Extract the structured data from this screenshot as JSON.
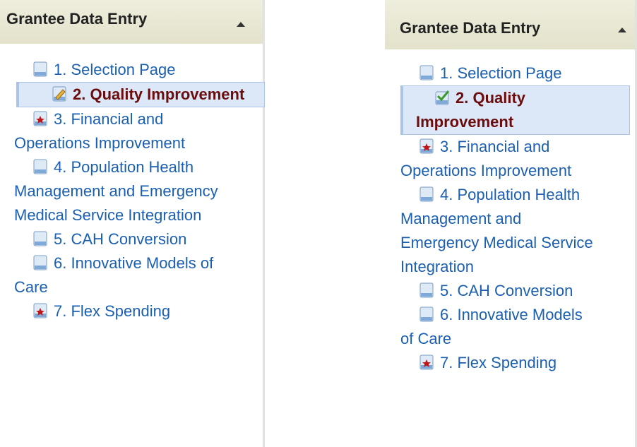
{
  "panels": [
    {
      "title": "Grantee Data Entry",
      "items": [
        {
          "label": "1. Selection Page",
          "icon": "page-icon"
        },
        {
          "label": "2. Quality Improvement",
          "icon": "edit-icon",
          "active": true
        },
        {
          "label": "3. Financial and Operations Improvement",
          "icon": "required-star-icon"
        },
        {
          "label": "4. Population Health Management and Emergency Medical Service Integration",
          "icon": "page-icon"
        },
        {
          "label": "5. CAH Conversion",
          "icon": "page-icon"
        },
        {
          "label": "6. Innovative Models of Care",
          "icon": "page-icon"
        },
        {
          "label": "7. Flex Spending",
          "icon": "required-star-icon"
        }
      ]
    },
    {
      "title": "Grantee Data Entry",
      "items": [
        {
          "label": "1. Selection Page",
          "icon": "page-icon"
        },
        {
          "label": "2. Quality Improvement",
          "icon": "checkmark-icon",
          "active": true
        },
        {
          "label": "3. Financial and Operations Improvement",
          "icon": "required-star-icon"
        },
        {
          "label": "4. Population Health Management and Emergency Medical Service Integration",
          "icon": "page-icon"
        },
        {
          "label": "5. CAH Conversion",
          "icon": "page-icon"
        },
        {
          "label": "6. Innovative Models of Care",
          "icon": "page-icon"
        },
        {
          "label": "7. Flex Spending",
          "icon": "required-star-icon"
        }
      ]
    }
  ],
  "colors": {
    "link": "#1b5fb0",
    "active_text": "#6b0d0d",
    "active_bg": "#dce8f8",
    "header_bg": "#e8e7d2"
  }
}
